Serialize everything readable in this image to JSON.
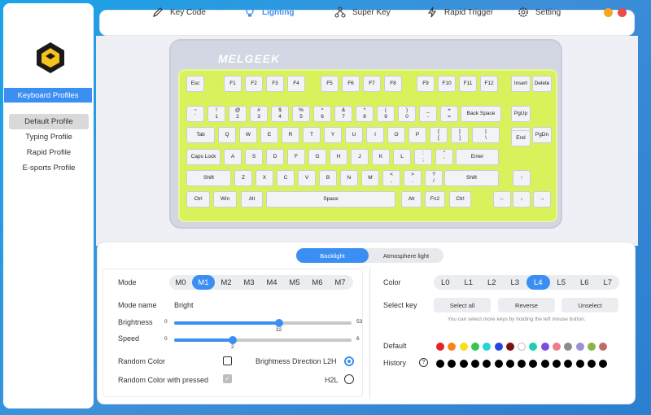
{
  "sidebar": {
    "header": "Keyboard Profiles",
    "profiles": [
      "Default Profile",
      "Typing Profile",
      "Rapid Profile",
      "E-sports Profile"
    ]
  },
  "nav": [
    {
      "label": "Key Code",
      "icon": "pen-icon"
    },
    {
      "label": "Lighting",
      "icon": "bulb-icon"
    },
    {
      "label": "Super Key",
      "icon": "nodes-icon"
    },
    {
      "label": "Rapid Trigger",
      "icon": "bolt-icon"
    },
    {
      "label": "Setting",
      "icon": "gear-icon"
    }
  ],
  "window_buttons": {
    "min": "#f5a623",
    "close": "#e94b4b"
  },
  "brand": "MELGEEK",
  "keys": {
    "row0": [
      "Esc",
      "F1",
      "F2",
      "F3",
      "F4",
      "F5",
      "F6",
      "F7",
      "F8",
      "F9",
      "F10",
      "F11",
      "F12",
      "Insert",
      "Delete"
    ],
    "row1": [
      "~\n`",
      "!\n1",
      "@\n2",
      "#\n3",
      "$\n4",
      "%\n5",
      "^\n6",
      "&\n7",
      "*\n8",
      "(\n9",
      ")\n0",
      "_\n-",
      "+\n=",
      "Back Space",
      "PgUp"
    ],
    "row2": [
      "Tab",
      "Q",
      "W",
      "E",
      "R",
      "T",
      "Y",
      "U",
      "I",
      "O",
      "P",
      "{\n[",
      "}\n]",
      "|\n\\",
      "Home",
      "PgDn"
    ],
    "row2b": [
      "End"
    ],
    "row3": [
      "Caps Lock",
      "A",
      "S",
      "D",
      "F",
      "G",
      "H",
      "J",
      "K",
      "L",
      ":\n;",
      "\"\n'",
      "Enter"
    ],
    "row4": [
      "Shift",
      "Z",
      "X",
      "C",
      "V",
      "B",
      "N",
      "M",
      "<\n,",
      ">\n.",
      "?\n/",
      "Shift",
      "↑"
    ],
    "row5": [
      "Ctrl",
      "Win",
      "Alt",
      "Space",
      "Alt",
      "Fn2",
      "Ctrl",
      "←",
      "↓",
      "→"
    ]
  },
  "tabs": {
    "backlight": "Backlight",
    "atmosphere": "Atmosphere light"
  },
  "left": {
    "mode_label": "Mode",
    "modes": [
      "M0",
      "M1",
      "M2",
      "M3",
      "M4",
      "M5",
      "M6",
      "M7"
    ],
    "mode_selected": "M1",
    "mode_name_label": "Mode name",
    "mode_name": "Bright",
    "brightness_label": "Brightness",
    "brightness_min": "0",
    "brightness_max": "53",
    "brightness_value": "32",
    "speed_label": "Speed",
    "speed_min": "0",
    "speed_max": "6",
    "speed_value": "2",
    "random_color": "Random Color",
    "random_pressed": "Random Color with pressed",
    "dir_l2h": "Brightness Direction L2H",
    "dir_h2l": "H2L"
  },
  "right": {
    "color_label": "Color",
    "levels": [
      "L0",
      "L1",
      "L2",
      "L3",
      "L4",
      "L5",
      "L6",
      "L7"
    ],
    "level_selected": "L4",
    "select_key_label": "Select key",
    "select_all": "Select all",
    "reverse": "Reverse",
    "unselect": "Unselect",
    "hint": "You can select more keys by holding the left mouse button.",
    "default_label": "Default",
    "history_label": "History",
    "default_colors": [
      "#e5212b",
      "#f5841f",
      "#f7e01b",
      "#36c64a",
      "#22d6d6",
      "#2546e6",
      "#7a1010",
      "#ffffff",
      "#1fcdb5",
      "#7a4fe0",
      "#f07b8b",
      "#8a8c8f",
      "#9b8fd8",
      "#87b54a",
      "#c06a6a"
    ],
    "history_colors": [
      "#000000",
      "#000000",
      "#000000",
      "#000000",
      "#000000",
      "#000000",
      "#000000",
      "#000000",
      "#000000",
      "#000000",
      "#000000",
      "#000000",
      "#000000",
      "#000000",
      "#000000"
    ]
  }
}
